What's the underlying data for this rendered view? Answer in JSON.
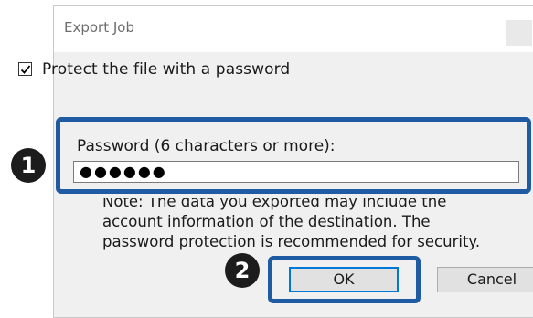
{
  "dialog": {
    "title": "Export Job",
    "checkbox": {
      "label": "Protect the file with a password",
      "checked": true
    },
    "password": {
      "label": "Password (6 characters or more):",
      "value": "●●●●●●"
    },
    "note": "Note: The data you exported may include the\naccount information of the destination. The\npassword protection is recommended for security.",
    "buttons": {
      "ok": "OK",
      "cancel": "Cancel"
    }
  },
  "markers": {
    "one": "1",
    "two": "2"
  },
  "colors": {
    "highlight": "#1f5ba3",
    "marker": "#1c1c1c",
    "dialog_bg": "#f0f0f0"
  },
  "icons": {
    "checkbox": "checkmark-icon",
    "close": "close-icon"
  }
}
